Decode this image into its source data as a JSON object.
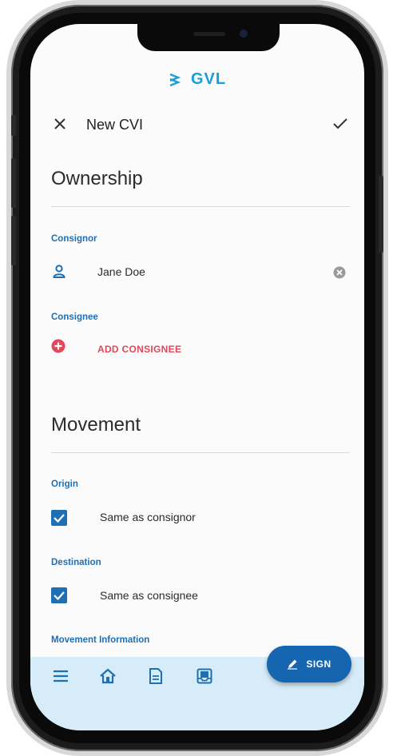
{
  "brand": {
    "name": "GVL",
    "color": "#1a9fd9"
  },
  "header": {
    "title": "New CVI",
    "close_icon": "close-icon",
    "confirm_icon": "check-icon"
  },
  "ownership": {
    "title": "Ownership",
    "consignor": {
      "label": "Consignor",
      "value": "Jane Doe",
      "icon": "person-icon",
      "clear_icon": "clear-circle-icon"
    },
    "consignee": {
      "label": "Consignee",
      "action": "ADD CONSIGNEE",
      "icon": "add-circle-icon"
    }
  },
  "movement": {
    "title": "Movement",
    "origin": {
      "label": "Origin",
      "checkbox_label": "Same as consignor",
      "checked": true
    },
    "destination": {
      "label": "Destination",
      "checkbox_label": "Same as consignee",
      "checked": true
    },
    "info_label": "Movement Information"
  },
  "bottom_nav": {
    "items": [
      "menu-icon",
      "home-icon",
      "document-icon",
      "inbox-icon"
    ],
    "fab": {
      "label": "SIGN",
      "icon": "pencil-icon"
    }
  },
  "colors": {
    "accent": "#1f6fb4",
    "danger": "#e2475a",
    "bar": "#d6ecf8",
    "fab": "#1565b0"
  }
}
